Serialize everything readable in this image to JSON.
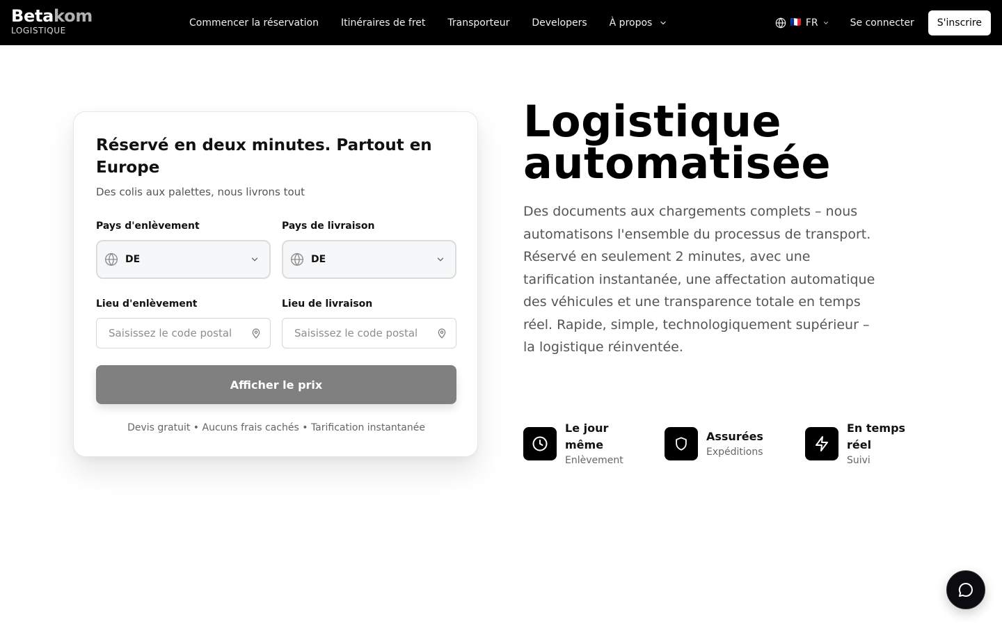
{
  "brand": {
    "name_a": "Beta",
    "name_b": "kom",
    "subtitle": "LOGISTIQUE"
  },
  "nav": {
    "items": [
      {
        "label": "Commencer la réservation"
      },
      {
        "label": "Itinéraires de fret"
      },
      {
        "label": "Transporteur"
      },
      {
        "label": "Developers"
      },
      {
        "label": "À propos"
      }
    ],
    "language": {
      "flag": "🇫🇷",
      "code": "FR"
    },
    "login": "Se connecter",
    "signup": "S'inscrire"
  },
  "booking": {
    "title": "Réservé en deux minutes. Partout en Europe",
    "subtitle": "Des colis aux palettes, nous livrons tout",
    "pickup_country_label": "Pays d'enlèvement",
    "pickup_country_value": "DE",
    "delivery_country_label": "Pays de livraison",
    "delivery_country_value": "DE",
    "pickup_location_label": "Lieu d'enlèvement",
    "pickup_location_placeholder": "Saisissez le code postal",
    "delivery_location_label": "Lieu de livraison",
    "delivery_location_placeholder": "Saisissez le code postal",
    "cta": "Afficher le prix",
    "footnote": "Devis gratuit • Aucuns frais cachés • Tarification instantanée"
  },
  "hero": {
    "title_line1": "Logistique",
    "title_line2": "automatisée",
    "description": "Des documents aux chargements complets – nous automatisons l'ensemble du processus de transport. Réservé en seulement 2 minutes, avec une tarification instantanée, une affectation automatique des véhicules et une transparence totale en temps réel. Rapide, simple, technologiquement supérieur – la logistique réinventée."
  },
  "features": [
    {
      "icon": "clock-icon",
      "title": "Le jour même",
      "subtitle": "Enlèvement"
    },
    {
      "icon": "shield-icon",
      "title": "Assurées",
      "subtitle": "Expéditions"
    },
    {
      "icon": "lightning-icon",
      "title": "En temps réel",
      "subtitle": "Suivi"
    }
  ],
  "colors": {
    "header_bg": "#000000",
    "cta_bg": "#808080",
    "icon_bg": "#000000",
    "chat_bg": "#0b0b10"
  }
}
